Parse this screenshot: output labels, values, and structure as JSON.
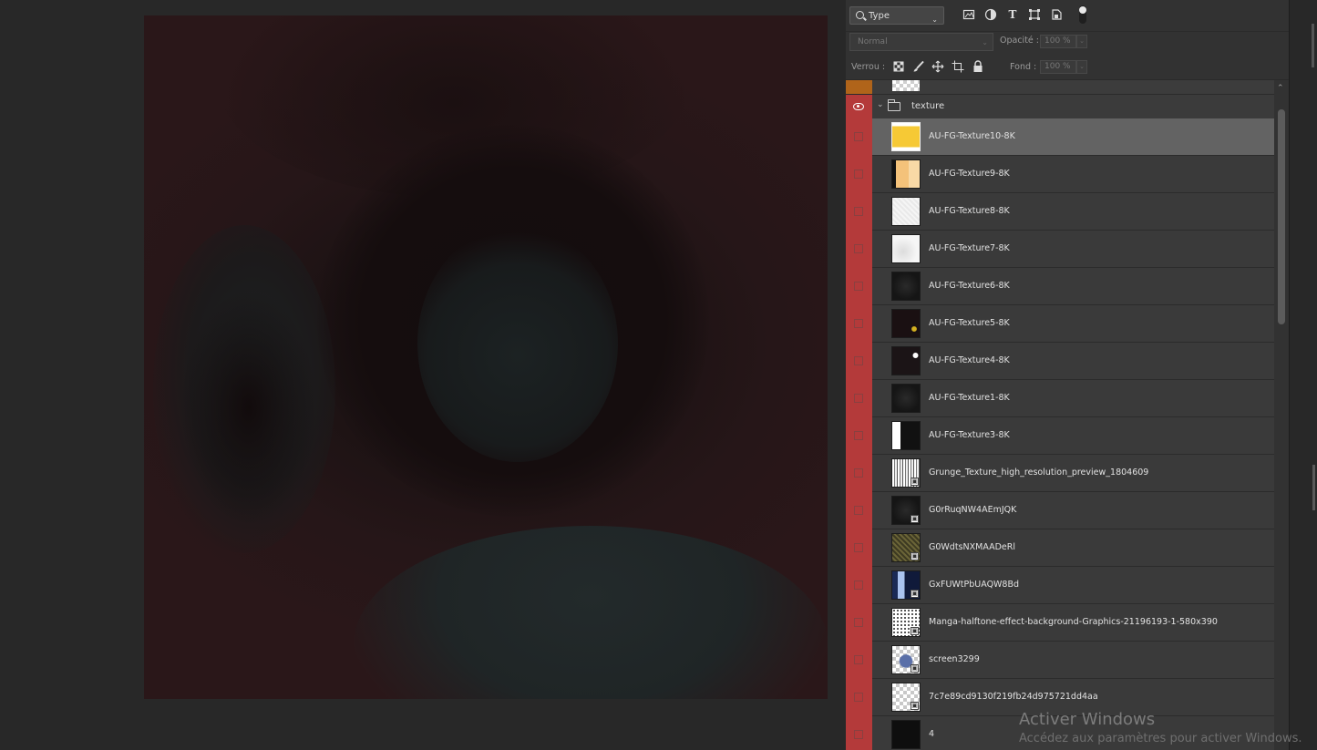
{
  "layers_panel": {
    "filter": {
      "label": "Type",
      "icons": [
        "image-filter-icon",
        "adjustment-filter-icon",
        "type-filter-icon",
        "shape-filter-icon",
        "smart-object-filter-icon",
        "filter-toggle-icon"
      ]
    },
    "blend_mode": "Normal",
    "opacity_label": "Opacité :",
    "opacity_value": "100 %",
    "lock_label": "Verrou :",
    "fill_label": "Fond :",
    "fill_value": "100 %",
    "group": {
      "name": "texture",
      "expanded": true,
      "visible": true
    },
    "layers": [
      {
        "name": "AU-FG-Texture10-8K",
        "selected": true,
        "smart_object": false,
        "thumb": "yellow"
      },
      {
        "name": "AU-FG-Texture9-8K",
        "selected": false,
        "smart_object": false,
        "thumb": "peach"
      },
      {
        "name": "AU-FG-Texture8-8K",
        "selected": false,
        "smart_object": false,
        "thumb": "white-noise"
      },
      {
        "name": "AU-FG-Texture7-8K",
        "selected": false,
        "smart_object": false,
        "thumb": "white"
      },
      {
        "name": "AU-FG-Texture6-8K",
        "selected": false,
        "smart_object": false,
        "thumb": "dark"
      },
      {
        "name": "AU-FG-Texture5-8K",
        "selected": false,
        "smart_object": false,
        "thumb": "dark-speck"
      },
      {
        "name": "AU-FG-Texture4-8K",
        "selected": false,
        "smart_object": false,
        "thumb": "dark-white"
      },
      {
        "name": "AU-FG-Texture1-8K",
        "selected": false,
        "smart_object": false,
        "thumb": "dark"
      },
      {
        "name": "AU-FG-Texture3-8K",
        "selected": false,
        "smart_object": false,
        "thumb": "white-black"
      },
      {
        "name": "Grunge_Texture_high_resolution_preview_1804609",
        "selected": false,
        "smart_object": true,
        "thumb": "grunge"
      },
      {
        "name": "G0rRuqNW4AEmJQK",
        "selected": false,
        "smart_object": true,
        "thumb": "dark"
      },
      {
        "name": "G0WdtsNXMAADeRl",
        "selected": false,
        "smart_object": true,
        "thumb": "olive"
      },
      {
        "name": "GxFUWtPbUAQW8Bd",
        "selected": false,
        "smart_object": true,
        "thumb": "blue"
      },
      {
        "name": "Manga-halftone-effect-background-Graphics-21196193-1-580x390",
        "selected": false,
        "smart_object": true,
        "thumb": "halftone"
      },
      {
        "name": "screen3299",
        "selected": false,
        "smart_object": true,
        "thumb": "screen"
      },
      {
        "name": "7c7e89cd9130f219fb24d975721dd4aa",
        "selected": false,
        "smart_object": true,
        "thumb": "light-checker"
      },
      {
        "name": "4",
        "selected": false,
        "smart_object": false,
        "thumb": "black"
      }
    ]
  },
  "watermark": {
    "title": "Activer Windows",
    "subtitle": "Accédez aux paramètres pour activer Windows."
  },
  "colors": {
    "visibility_red": "#b43a3a",
    "visibility_orange": "#b0641a",
    "selected_row": "#636363",
    "panel_bg": "#323232",
    "workspace_bg": "#282828"
  }
}
